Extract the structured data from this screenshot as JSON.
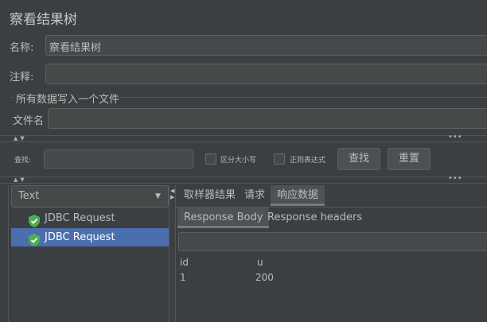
{
  "window_title": "察看结果树",
  "name_label": "名称:",
  "name_value": "察看结果树",
  "comment_label": "注释:",
  "comment_value": "",
  "write_all_label": "所有数据写入一个文件",
  "filename_label": "文件名",
  "filename_value": "",
  "search": {
    "label": "查找:",
    "value": "",
    "case_sensitive_label": "区分大小写",
    "regex_label": "正则表达式",
    "find_button": "查找",
    "reset_button": "重置"
  },
  "renderer_select": {
    "selected": "Text"
  },
  "tree": {
    "items": [
      {
        "label": "JDBC Request",
        "selected": false
      },
      {
        "label": "JDBC Request",
        "selected": true
      }
    ]
  },
  "result_tabs": {
    "tabs": [
      {
        "label": "取样器结果",
        "active": false
      },
      {
        "label": "请求",
        "active": false
      },
      {
        "label": "响应数据",
        "active": true
      }
    ]
  },
  "response_tabs": {
    "tabs": [
      {
        "label": "Response Body",
        "active": true
      },
      {
        "label": "Response headers",
        "active": false
      }
    ]
  },
  "response_search_value": "",
  "response_body": {
    "headers": [
      "id",
      "u"
    ],
    "rows": [
      [
        "1",
        "200"
      ]
    ]
  },
  "colors": {
    "background": "#3c3f41",
    "selection": "#4b6eaf",
    "shield_green": "#4caf50"
  }
}
